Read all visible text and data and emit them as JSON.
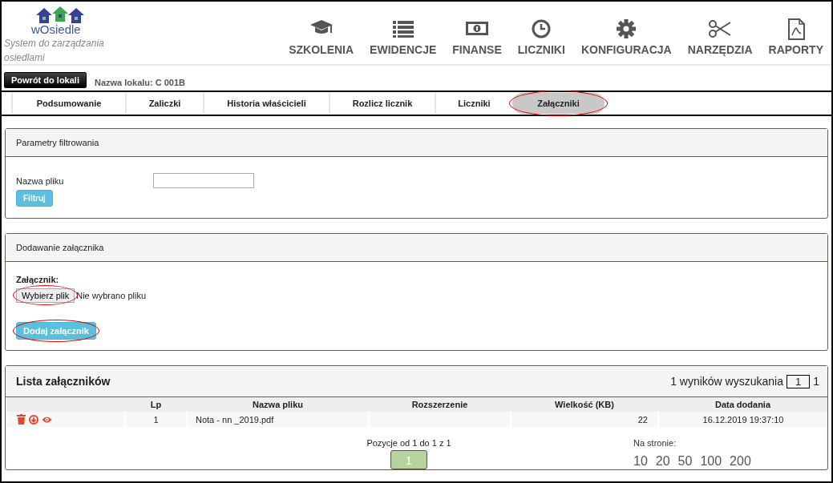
{
  "logo": {
    "name": "wOsiedle",
    "tagline": "System do zarządzania osiedlami"
  },
  "nav": [
    {
      "label": "SZKOLENIA",
      "kind": "cap"
    },
    {
      "label": "EWIDENCJE",
      "kind": "list"
    },
    {
      "label": "FINANSE",
      "kind": "money"
    },
    {
      "label": "LICZNIKI",
      "kind": "clock"
    },
    {
      "label": "KONFIGURACJA",
      "kind": "gear"
    },
    {
      "label": "NARZĘDZIA",
      "kind": "scissors"
    },
    {
      "label": "RAPORTY",
      "kind": "pdf"
    }
  ],
  "back_button": "Powrót do lokali",
  "unit_name": "Nazwa lokalu: C 001B",
  "tabs": [
    {
      "label": "Podsumowanie",
      "selected": false,
      "circled": false
    },
    {
      "label": "Zaliczki",
      "selected": false,
      "circled": false
    },
    {
      "label": "Historia właścicieli",
      "selected": false,
      "circled": false
    },
    {
      "label": "Rozlicz licznik",
      "selected": false,
      "circled": false
    },
    {
      "label": "Liczniki",
      "selected": false,
      "circled": false
    },
    {
      "label": "Załączniki",
      "selected": true,
      "circled": true
    }
  ],
  "filter_panel": {
    "title": "Parametry filtrowania",
    "field_label": "Nazwa pliku",
    "button": "Filtruj"
  },
  "upload_panel": {
    "title": "Dodawanie załącznika",
    "label": "Załącznik:",
    "file_button": {
      "label": "Wybierz plik",
      "circled": true
    },
    "file_status": "Nie wybrano pliku",
    "add_button": {
      "label": "Dodaj załącznik",
      "circled": true
    }
  },
  "list_panel": {
    "title": "Lista załączników",
    "results": "1 wyników wyszukania",
    "page_input": "1",
    "page_total": "1",
    "table": {
      "columns": [
        "Lp",
        "Nazwa pliku",
        "Rozszerzenie",
        "Wielkość (KB)",
        "Data dodania"
      ],
      "rows": [
        {
          "cells": [
            "1",
            "Nota - nn _2019.pdf",
            "",
            "22",
            "16.12.2019 19:37:10"
          ]
        }
      ]
    },
    "range": "Pozycje od 1 do 1 z 1",
    "pages": [
      {
        "label": "1",
        "selected": true
      }
    ],
    "per_page_label": "Na stronie:",
    "per_page": [
      "10",
      "20",
      "50",
      "100",
      "200"
    ]
  }
}
